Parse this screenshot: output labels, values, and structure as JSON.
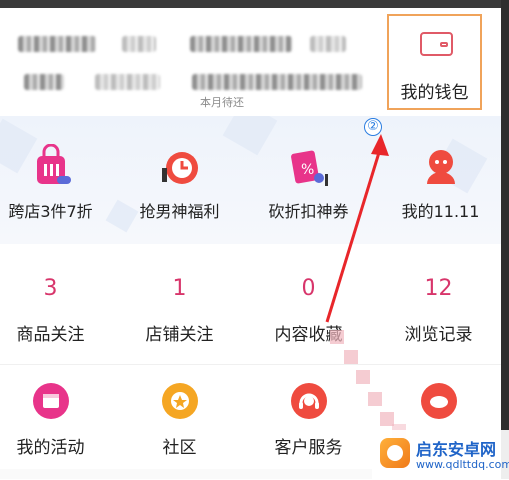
{
  "header": {
    "pending_label": "本月待还"
  },
  "wallet": {
    "label": "我的钱包",
    "icon": "wallet-icon",
    "highlight_color": "#f0a35a"
  },
  "annotation": {
    "marker": "②",
    "arrow_color": "#e8262a"
  },
  "promo": {
    "items": [
      {
        "label": "跨店3件7折",
        "icon": "shopping-bag-icon"
      },
      {
        "label": "抢男神福利",
        "icon": "gift-clock-icon"
      },
      {
        "label": "砍折扣神券",
        "icon": "discount-coupon-icon"
      },
      {
        "label": "我的11.11",
        "icon": "red-avatar-icon"
      }
    ]
  },
  "stats": {
    "items": [
      {
        "value": "3",
        "label": "商品关注"
      },
      {
        "value": "1",
        "label": "店铺关注"
      },
      {
        "value": "0",
        "label": "内容收藏"
      },
      {
        "value": "12",
        "label": "浏览记录"
      }
    ],
    "number_color": "#d8356b"
  },
  "services": {
    "items": [
      {
        "label": "我的活动",
        "icon": "calendar-icon",
        "color": "#e8348a"
      },
      {
        "label": "社区",
        "icon": "community-icon",
        "color": "#f5a623"
      },
      {
        "label": "客户服务",
        "icon": "headset-icon",
        "color": "#ef4b3f"
      },
      {
        "label": "",
        "icon": "heart-icon",
        "color": "#ef4b3f"
      }
    ]
  },
  "watermark": {
    "title": "启东安卓网",
    "url": "www.qdlttdq.com"
  }
}
